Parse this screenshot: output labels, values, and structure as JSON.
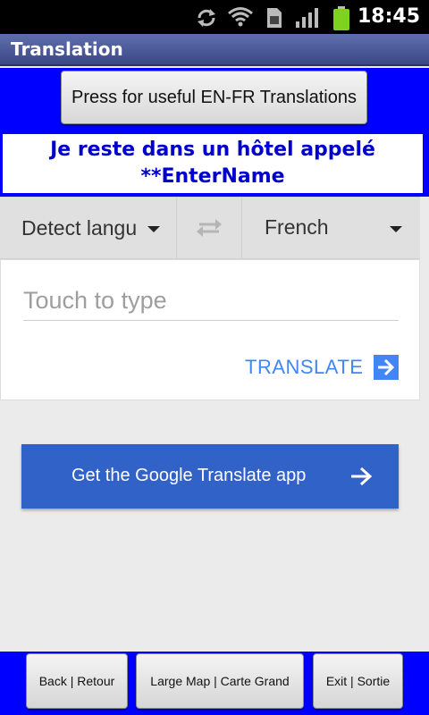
{
  "status_bar": {
    "time": "18:45",
    "icons": [
      "sync-icon",
      "wifi-icon",
      "sim-icon",
      "signal-icon",
      "battery-icon"
    ],
    "battery_color": "#7ed321"
  },
  "titlebar": {
    "title": "Translation"
  },
  "header": {
    "useful_button_label": "Press for useful EN-FR Translations",
    "phrase_line1": "Je reste dans un hôtel appelé",
    "phrase_line2": "**EnterName"
  },
  "language_bar": {
    "source": "Detect language",
    "target": "French",
    "swap_icon": "swap-arrows-icon"
  },
  "input_card": {
    "placeholder": "Touch to type",
    "translate_label": "TRANSLATE",
    "translate_icon": "arrow-right-box-icon"
  },
  "get_app": {
    "label": "Get the Google Translate app",
    "icon": "arrow-right-icon"
  },
  "bottom_bar": {
    "back_label": "Back | Retour",
    "map_label": "Large Map | Carte Grand",
    "exit_label": "Exit | Sortie"
  },
  "colors": {
    "blue_background": "#0000ff",
    "phrase_text": "#0000cc",
    "google_blue": "#4285f4",
    "app_button": "#3062c8"
  }
}
